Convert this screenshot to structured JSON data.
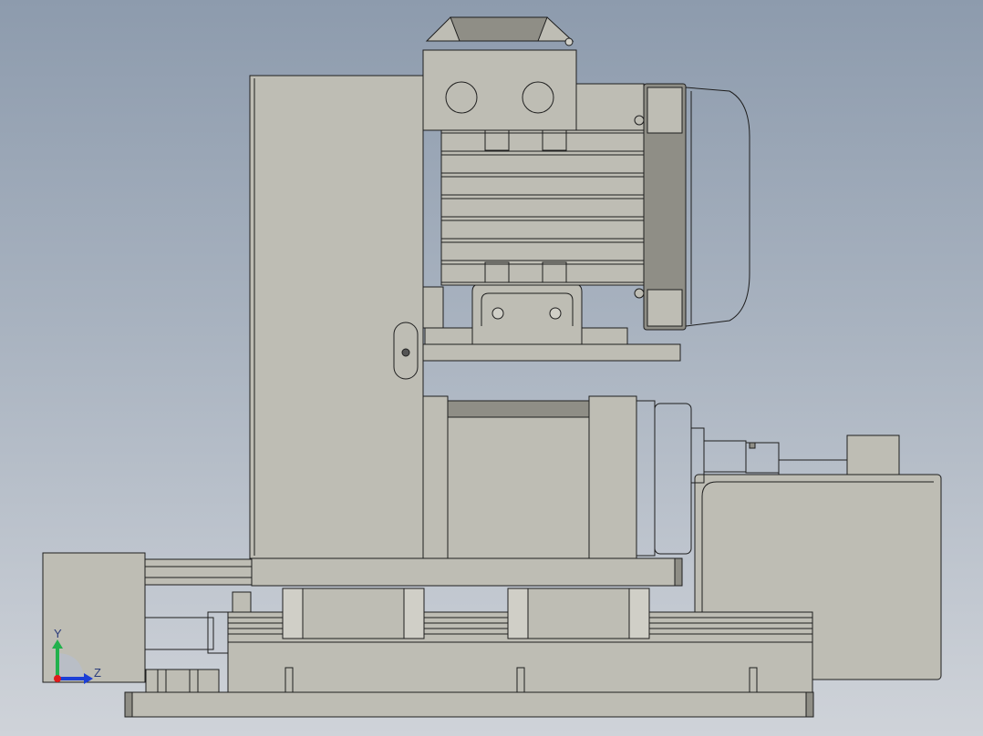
{
  "viewport": {
    "background_top": "#8d9bad",
    "background_bottom": "#cfd3d9"
  },
  "model": {
    "body_color": "#bebdb4",
    "shadow_color": "#8f8e86",
    "edge_color": "#1e1e1e"
  },
  "triad": {
    "y_label": "Y",
    "z_label": "Z",
    "y_color": "#22b14c",
    "z_color": "#1c3fd6",
    "origin_color": "#e01b1b"
  }
}
